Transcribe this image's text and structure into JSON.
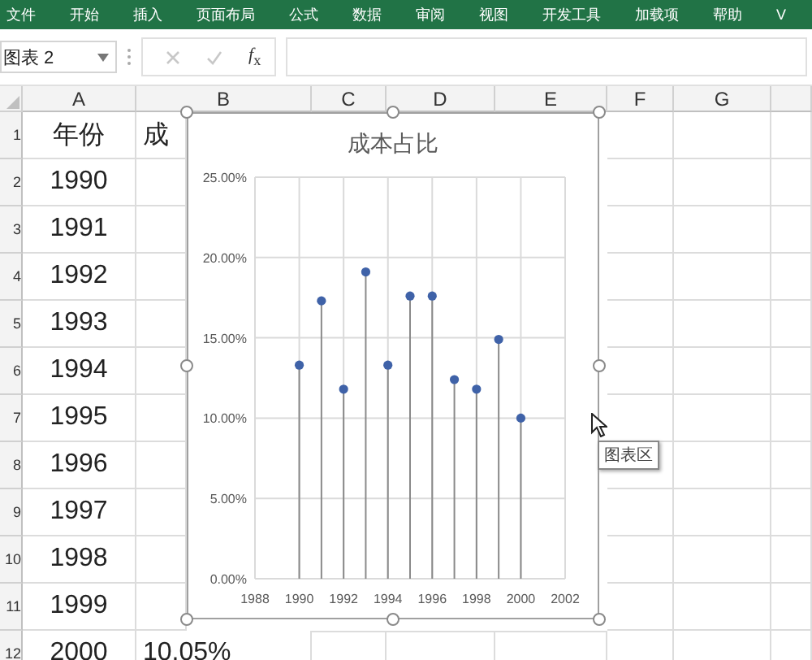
{
  "ribbon": {
    "tabs": [
      {
        "label": "文件"
      },
      {
        "label": "开始"
      },
      {
        "label": "插入"
      },
      {
        "label": "页面布局"
      },
      {
        "label": "公式"
      },
      {
        "label": "数据"
      },
      {
        "label": "审阅"
      },
      {
        "label": "视图"
      },
      {
        "label": "开发工具"
      },
      {
        "label": "加载项"
      },
      {
        "label": "帮助"
      },
      {
        "label": "V"
      }
    ]
  },
  "formula_bar": {
    "name_box": "图表 2",
    "cancel_disabled": true,
    "enter_disabled": true,
    "function_label": "*f*$_{x}$"
  },
  "columns": [
    "A",
    "B",
    "C",
    "D",
    "E",
    "F",
    "G"
  ],
  "rows": [
    {
      "number": "1",
      "cells": [
        "年份",
        "成"
      ]
    },
    {
      "number": "2",
      "cells": [
        "1990"
      ]
    },
    {
      "number": "3",
      "cells": [
        "1991"
      ]
    },
    {
      "number": "4",
      "cells": [
        "1992"
      ]
    },
    {
      "number": "5",
      "cells": [
        "1993"
      ]
    },
    {
      "number": "6",
      "cells": [
        "1994"
      ]
    },
    {
      "number": "7",
      "cells": [
        "1995"
      ]
    },
    {
      "number": "8",
      "cells": [
        "1996"
      ]
    },
    {
      "number": "9",
      "cells": [
        "1997"
      ]
    },
    {
      "number": "10",
      "cells": [
        "1998"
      ]
    },
    {
      "number": "11",
      "cells": [
        "1999"
      ]
    },
    {
      "number": "12",
      "cells": [
        "2000",
        "10.05%"
      ]
    }
  ],
  "chart": {
    "chart_data": {
      "type": "scatter",
      "title": "成本占比",
      "x": [
        1990,
        1991,
        1992,
        1993,
        1994,
        1995,
        1996,
        1997,
        1998,
        1999,
        2000
      ],
      "series": [
        {
          "color": "#3f62a8",
          "values": [
            0.133,
            0.173,
            0.118,
            0.191,
            0.133,
            0.176,
            0.176,
            0.124,
            0.118,
            0.149,
            0.1
          ],
          "errors": [
            [
              0.133,
              0
            ],
            [
              0.173,
              0
            ],
            [
              0.118,
              0
            ],
            [
              0.191,
              0
            ],
            [
              0.133,
              0
            ],
            [
              0.176,
              0
            ],
            [
              0.176,
              0
            ],
            [
              0.124,
              0
            ],
            [
              0.118,
              0
            ],
            [
              0.149,
              0
            ],
            [
              0.1,
              0
            ]
          ]
        }
      ],
      "grid": true,
      "xlim": [
        1988,
        2002
      ],
      "ylim": [
        0,
        0.25
      ],
      "xticks": [
        1988,
        1990,
        1992,
        1994,
        1996,
        1998,
        2000,
        2002
      ],
      "yticks": [
        {
          "value": 0,
          "label": "0.00%"
        },
        {
          "value": 0.05,
          "label": "5.00%"
        },
        {
          "value": 0.1,
          "label": "10.00%"
        },
        {
          "value": 0.15,
          "label": "15.00%"
        },
        {
          "value": 0.2,
          "label": "20.00%"
        },
        {
          "value": 0.25,
          "label": "25.00%"
        }
      ]
    }
  },
  "tooltip": "图表区"
}
